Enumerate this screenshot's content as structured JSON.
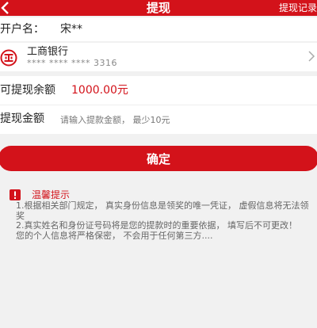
{
  "header": {
    "title": "提现",
    "record_link": "提现记录"
  },
  "account": {
    "label": "开户名：",
    "holder": "宋**"
  },
  "bank": {
    "name": "工商银行",
    "card_number": "**** **** **** 3316"
  },
  "balance": {
    "label": "可提现余额",
    "value": "1000.00元"
  },
  "amount": {
    "label": "提现金额",
    "value": "",
    "placeholder": "请输入提款金额， 最少10元"
  },
  "confirm_label": "确定",
  "tips": {
    "title": "温馨提示",
    "lines": [
      "1.根据相关部门规定， 真实身份信息是领奖的唯一凭证， 虚假信息将无法领奖",
      "2.真实姓名和身份证号码将是您的提款时的重要依据， 填写后不可更改！",
      "您的个人信息将严格保密， 不会用于任何第三方...."
    ]
  },
  "colors": {
    "brand": "#d3121a",
    "background": "#f1f1f1"
  },
  "icons": {
    "back": "back-arrow-icon",
    "bank": "icbc-logo-icon",
    "chevron": "chevron-right-icon",
    "warning": "warning-icon"
  }
}
